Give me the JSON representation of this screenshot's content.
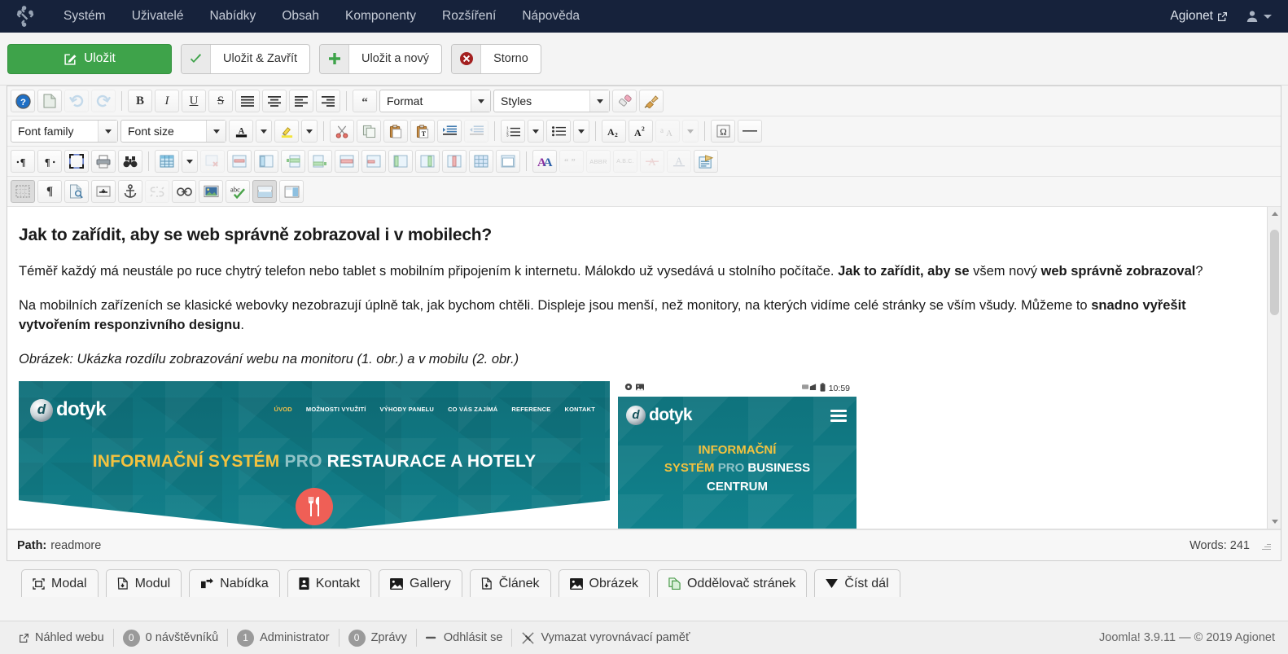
{
  "topbar": {
    "logo_icon": "joomla-logo-icon",
    "menu": [
      {
        "label": "Systém"
      },
      {
        "label": "Uživatelé"
      },
      {
        "label": "Nabídky"
      },
      {
        "label": "Obsah"
      },
      {
        "label": "Komponenty"
      },
      {
        "label": "Rozšíření"
      },
      {
        "label": "Nápověda"
      }
    ],
    "site_name": "Agionet",
    "site_icon": "external-link-icon",
    "user_icon": "user-avatar-icon",
    "bg_color": "#16223b"
  },
  "toolbar": {
    "save_label": "Uložit",
    "save_close_label": "Uložit & Zavřít",
    "save_new_label": "Uložit a nový",
    "cancel_label": "Storno",
    "save_color": "#3ea34a",
    "check_color": "#3ea34a",
    "plus_color": "#3ea34a",
    "cancel_color": "#a32020"
  },
  "editor": {
    "format_label": "Format",
    "styles_label": "Styles",
    "fontfamily_label": "Font family",
    "fontsize_label": "Font size",
    "path_label": "Path:",
    "path_value": "readmore",
    "wordcount": "Words: 241"
  },
  "content": {
    "heading": "Jak to zařídit, aby se web správně zobrazoval i v mobilech?",
    "p1_a": "Téměř každý má neustále po ruce chytrý telefon nebo tablet s mobilním připojením k internetu. Málokdo už vysedává u stolního počítače. ",
    "p1_b": "Jak to zařídit, aby se",
    "p1_c": " všem nový ",
    "p1_d": "web správně zobrazoval",
    "p1_e": "?",
    "p2_a": "Na mobilních zařízeních se klasické webovky nezobrazují úplně tak, jak bychom chtěli. Displeje jsou menší, než monitory, na kterých vidíme celé stránky se vším všudy. Můžeme to ",
    "p2_b": "snadno vyřešit vytvořením responzivního designu",
    "p2_c": ".",
    "caption": "Obrázek: Ukázka rozdílu zobrazování webu na monitoru (1. obr.) a v mobilu (2. obr.)"
  },
  "desktop_shot": {
    "logo_letter": "d",
    "logo_word": "dotyk",
    "nav": [
      "ÚVOD",
      "MOŽNOSTI VYUŽITÍ",
      "VÝHODY PANELU",
      "CO VÁS ZAJÍMÁ",
      "REFERENCE",
      "KONTAKT"
    ],
    "headline_1": "INFORMAČNÍ SYSTÉM",
    "headline_2": "PRO",
    "headline_3": "RESTAURACE A HOTELY",
    "teal": "#10717a",
    "yellow": "#f3c23f",
    "circle_color": "#ef5f56",
    "circle_icon": "fork-knife-icon"
  },
  "mobile_shot": {
    "time": "10:59",
    "status_icons": [
      "settings-icon",
      "image-icon",
      "signal-icon",
      "battery-icon"
    ],
    "logo_letter": "d",
    "logo_word": "dotyk",
    "menu_icon": "hamburger-menu-icon",
    "headline_1": "INFORMAČNÍ",
    "headline_2": "SYSTÉM",
    "headline_3": "PRO",
    "headline_4": "BUSINESS",
    "headline_5": "CENTRUM"
  },
  "insert_buttons": [
    {
      "label": "Modal",
      "icon": "modal-icon"
    },
    {
      "label": "Modul",
      "icon": "module-icon"
    },
    {
      "label": "Nabídka",
      "icon": "menu-share-icon"
    },
    {
      "label": "Kontakt",
      "icon": "contact-card-icon"
    },
    {
      "label": "Gallery",
      "icon": "gallery-image-icon"
    },
    {
      "label": "Článek",
      "icon": "article-icon"
    },
    {
      "label": "Obrázek",
      "icon": "picture-icon"
    },
    {
      "label": "Oddělovač stránek",
      "icon": "page-break-icon"
    },
    {
      "label": "Číst dál",
      "icon": "read-more-chevron-icon"
    }
  ],
  "footer": {
    "preview_label": "Náhled webu",
    "visitors_count": "0",
    "visitors_label": "0 návštěvníků",
    "admin_count": "1",
    "admin_label": "Administrator",
    "messages_count": "0",
    "messages_label": "Zprávy",
    "logout_label": "Odhlásit se",
    "clearcache_label": "Vymazat vyrovnávací paměť",
    "copyright": "Joomla! 3.9.11  —  © 2019 Agionet"
  }
}
